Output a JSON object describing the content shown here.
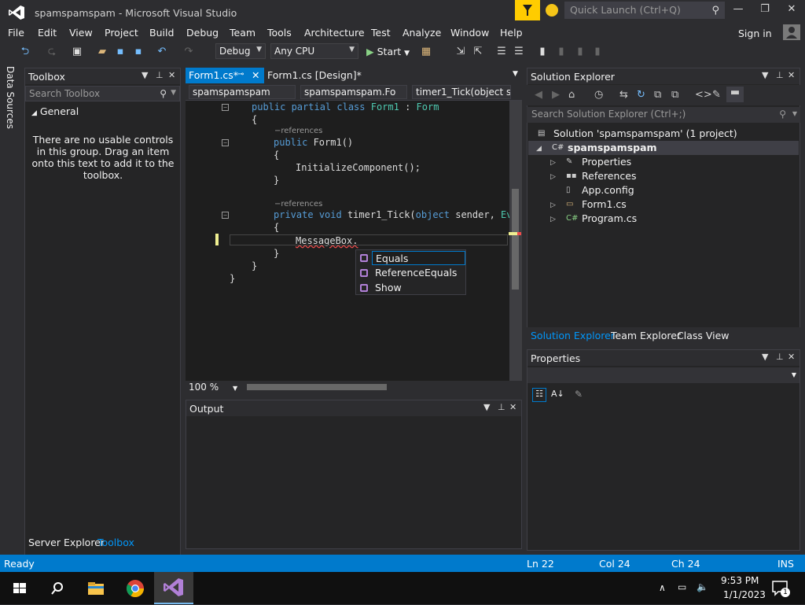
{
  "window": {
    "title": "spamspamspam - Microsoft Visual Studio",
    "quick_launch_placeholder": "Quick Launch (Ctrl+Q)"
  },
  "menu": [
    "File",
    "Edit",
    "View",
    "Project",
    "Build",
    "Debug",
    "Team",
    "Tools",
    "Architecture",
    "Test",
    "Analyze",
    "Window",
    "Help"
  ],
  "sign_in": "Sign in",
  "toolbar": {
    "config": "Debug",
    "platform": "Any CPU",
    "start_label": "Start"
  },
  "left_strip": {
    "data_sources": "Data Sources"
  },
  "toolbox": {
    "title": "Toolbox",
    "search_placeholder": "Search Toolbox",
    "group": "General",
    "message": "There are no usable controls in this group. Drag an item onto this text to add it to the toolbox.",
    "bottom_tabs": [
      "Server Explorer",
      "Toolbox"
    ]
  },
  "editor": {
    "tabs": [
      {
        "label": "Form1.cs*",
        "active": true
      },
      {
        "label": "Form1.cs [Design]*",
        "active": false
      }
    ],
    "nav": [
      "spamspamspam",
      "spamspamspam.Fo",
      "timer1_Tick(object s"
    ],
    "code": {
      "class_kw": "public partial class",
      "class_name": "Form1",
      "class_sep": " : ",
      "base": "Form",
      "open1": "{",
      "ref1": "−references",
      "ctor_kw": "public",
      "ctor": " Form1()",
      "open2": "{",
      "init": "InitializeComponent();",
      "close2": "}",
      "ref2": "−references",
      "method_kw1": "private",
      "method_kw2": "void",
      "method": " timer1_Tick(",
      "method_kw3": "object",
      "method_rest": " sender, ",
      "method_type": "Eve",
      "open3": "{",
      "typing": "MessageBox.",
      "close3": "}",
      "close1": "}",
      "close0": "}"
    },
    "autocomplete": [
      "Equals",
      "ReferenceEquals",
      "Show"
    ],
    "zoom": "100 %"
  },
  "output": {
    "title": "Output"
  },
  "solution_explorer": {
    "title": "Solution Explorer",
    "search_placeholder": "Search Solution Explorer (Ctrl+;)",
    "solution": "Solution 'spamspamspam' (1 project)",
    "project": "spamspamspam",
    "items": [
      "Properties",
      "References",
      "App.config",
      "Form1.cs",
      "Program.cs"
    ],
    "tabs": [
      "Solution Explorer",
      "Team Explorer",
      "Class View"
    ]
  },
  "properties": {
    "title": "Properties"
  },
  "status": {
    "ready": "Ready",
    "ln": "Ln 22",
    "col": "Col 24",
    "ch": "Ch 24",
    "mode": "INS"
  },
  "taskbar": {
    "time": "9:53 PM",
    "date": "1/1/2023",
    "notif_count": "1"
  },
  "colors": {
    "accent": "#007acc",
    "keyword": "#569cd6",
    "type": "#4ec9b0"
  }
}
